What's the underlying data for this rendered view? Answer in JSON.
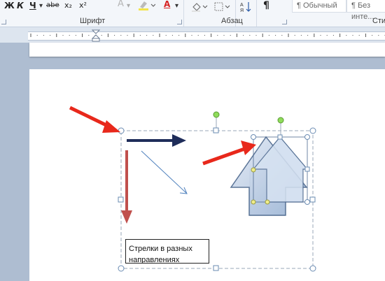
{
  "ribbon": {
    "bold": "Ж",
    "italic": "К",
    "underline": "Ч",
    "strikethrough": "abe",
    "subscript": "x₂",
    "superscript": "x²",
    "font_color_letter": "A",
    "font_group": "Шрифт",
    "paragraph_group": "Абзац",
    "pilcrow": "¶",
    "style_normal": "¶ Обычный",
    "style_nospacing": "¶ Без инте...",
    "styles_group": "Сти",
    "font_color": "#d62020",
    "highlight_color": "#f2e44a"
  },
  "document": {
    "textbox_text": "Стрелки в разных направлениях"
  },
  "annotation_arrow_color": "#e8281b",
  "shape_colors": {
    "navy_arrow": "#1f2d5a",
    "red_arrow": "#c0504d",
    "thin_arrow": "#4f81bd",
    "block_arrow_fill": "#b9cce4",
    "block_arrow_stroke": "#4f6a8f"
  }
}
